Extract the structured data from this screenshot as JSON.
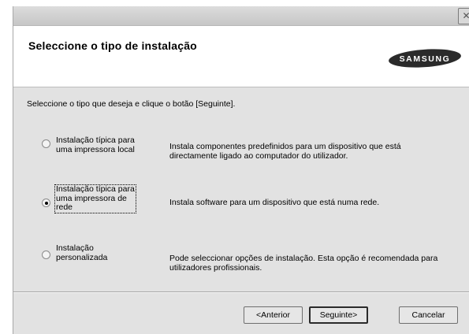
{
  "window": {
    "close_glyph": "✕"
  },
  "header": {
    "title": "Seleccione o tipo de instalação",
    "brand": "SAMSUNG"
  },
  "instruction": "Seleccione o tipo que deseja e clique o botão [Seguinte].",
  "options": [
    {
      "label_lines": [
        "Instalação típica para",
        "uma impressora local"
      ],
      "description_lines": [
        "Instala componentes predefinidos para um dispositivo que está",
        "directamente ligado ao computador do utilizador."
      ],
      "selected": false
    },
    {
      "label_lines": [
        "Instalação típica para",
        "uma impressora de",
        "rede"
      ],
      "description_lines": [
        "Instala software para um dispositivo que está numa rede."
      ],
      "selected": true
    },
    {
      "label_lines": [
        "Instalação",
        "personalizada"
      ],
      "description_lines": [
        "Pode seleccionar opções de instalação. Esta opção é recomendada para",
        "utilizadores profissionais."
      ],
      "selected": false
    }
  ],
  "buttons": {
    "back": "<Anterior",
    "next": "Seguinte>",
    "cancel": "Cancelar"
  }
}
